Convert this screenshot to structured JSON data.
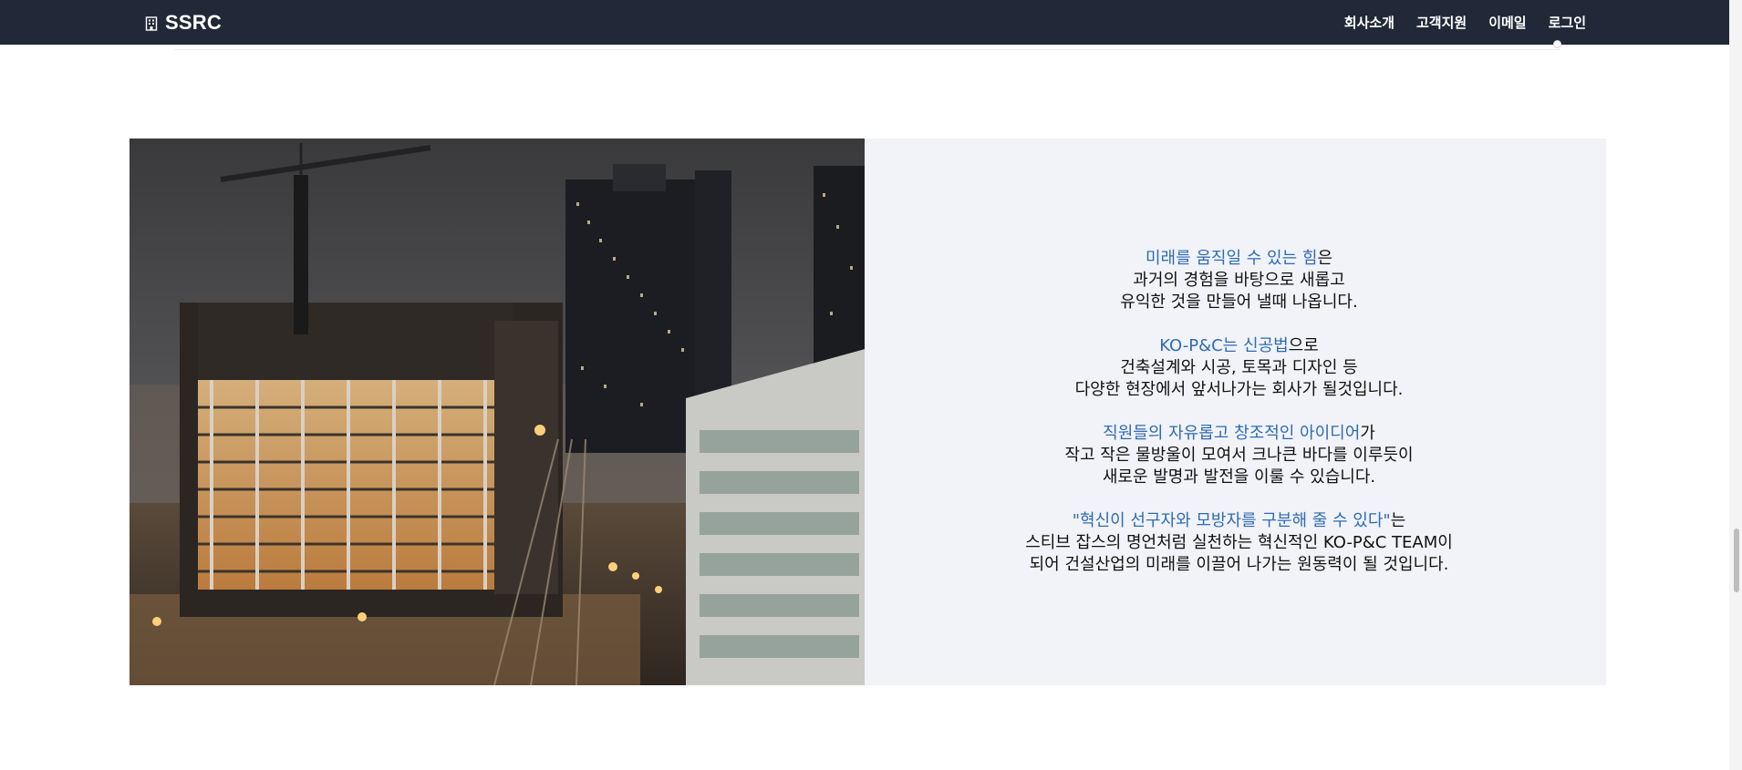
{
  "navbar": {
    "brand": "SSRC",
    "brand_icon": "building-icon",
    "links": [
      "회사소개",
      "고객지원",
      "이메일",
      "로그인"
    ]
  },
  "intro": {
    "photo_alt": "construction-site-night-photo",
    "paragraphs": [
      {
        "highlight": "미래를 움직일 수 있는 힘",
        "rest": "은",
        "lines": [
          "과거의 경험을 바탕으로 새롭고",
          "유익한 것을 만들어 낼때 나옵니다."
        ]
      },
      {
        "highlight": "KO-P&C는 신공법",
        "rest": "으로",
        "lines": [
          "건축설계와 시공, 토목과 디자인 등",
          "다양한 현장에서 앞서나가는 회사가 될것입니다."
        ]
      },
      {
        "highlight": "직원들의 자유롭고 창조적인 아이디어",
        "rest": "가",
        "lines": [
          "작고 작은 물방울이 모여서 크나큰 바다를 이루듯이",
          "새로운 발명과 발전을 이룰 수 있습니다."
        ]
      },
      {
        "highlight": "\"혁신이 선구자와 모방자를 구분해 줄 수 있다\"",
        "rest": "는",
        "lines": [
          "스티브 잡스의 명언처럼 실천하는 혁신적인 KO-P&C TEAM이",
          "되어 건설산업의 미래를 이끌어 나가는 원동력이 될 것입니다."
        ]
      }
    ]
  },
  "colors": {
    "navbar_bg": "#212938",
    "highlight": "#2e6bb3",
    "panel_bg": "#f1f3f8"
  }
}
